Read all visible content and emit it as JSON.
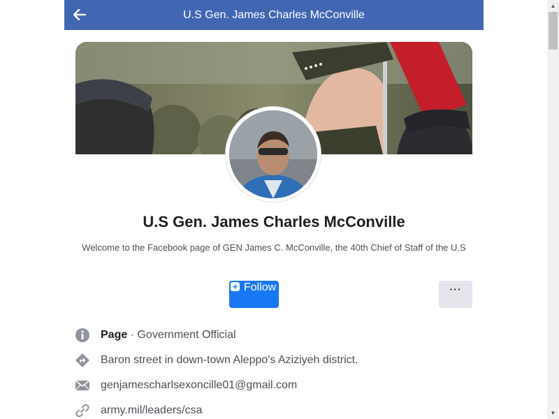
{
  "header": {
    "title": "U.S Gen. James Charles McConville",
    "back_icon": "arrow-left-icon",
    "color": "#4267b2"
  },
  "profile": {
    "name": "U.S Gen. James Charles McConville",
    "description": "Welcome to the Facebook page of GEN James C. McConville, the 40th Chief of Staff of the U.S"
  },
  "actions": {
    "follow_label": "Follow",
    "follow_icon": "plus-square-icon",
    "more_label": "···",
    "accent": "#1877f2"
  },
  "info": {
    "category_label": "Page",
    "category_sep": " · ",
    "category_value": "Government Official",
    "address": "Baron street in down-town Aleppo's Aziziyeh district.",
    "email": "genjamescharlsexoncille01@gmail.com",
    "website": "army.mil/leaders/csa"
  }
}
